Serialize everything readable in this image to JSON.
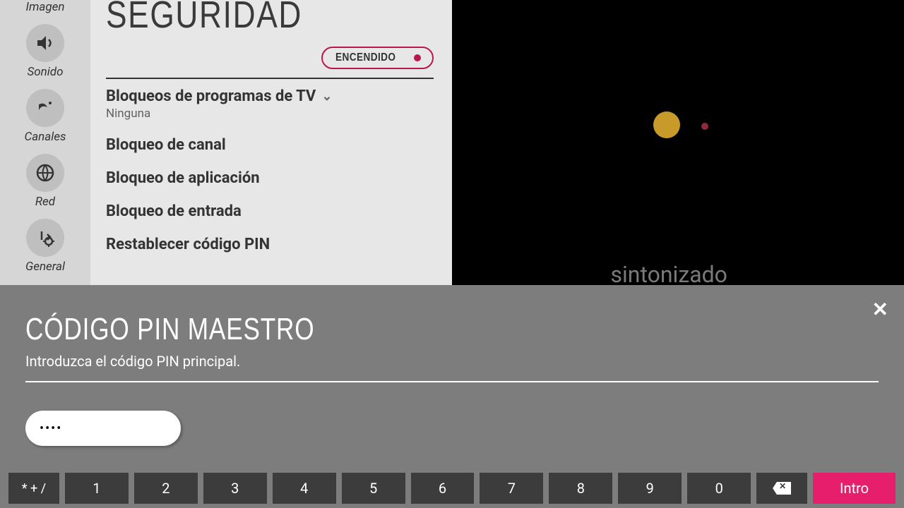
{
  "sidebar": {
    "items": [
      {
        "label": "Imagen",
        "icon": "image-icon"
      },
      {
        "label": "Sonido",
        "icon": "sound-icon"
      },
      {
        "label": "Canales",
        "icon": "channels-icon"
      },
      {
        "label": "Red",
        "icon": "network-icon"
      },
      {
        "label": "General",
        "icon": "general-icon"
      }
    ]
  },
  "panel": {
    "title": "SEGURIDAD",
    "toggle_label": "ENCENDIDO",
    "items": [
      {
        "title": "Bloqueos de programas de TV",
        "subtitle": "Ninguna",
        "expandable": true
      },
      {
        "title": "Bloqueo de canal"
      },
      {
        "title": "Bloqueo de aplicación"
      },
      {
        "title": "Bloqueo de entrada"
      },
      {
        "title": "Restablecer código PIN"
      }
    ]
  },
  "tv": {
    "status_text": "sintonizado"
  },
  "modal": {
    "title": "CÓDIGO PIN MAESTRO",
    "subtitle": "Introduzca el código PIN principal.",
    "pin_value": "••••"
  },
  "keypad": {
    "symbols": "* + /",
    "keys": [
      "1",
      "2",
      "3",
      "4",
      "5",
      "6",
      "7",
      "8",
      "9",
      "0"
    ],
    "enter": "Intro"
  },
  "colors": {
    "accent": "#e61e6b",
    "pill_border": "#b8164f"
  }
}
